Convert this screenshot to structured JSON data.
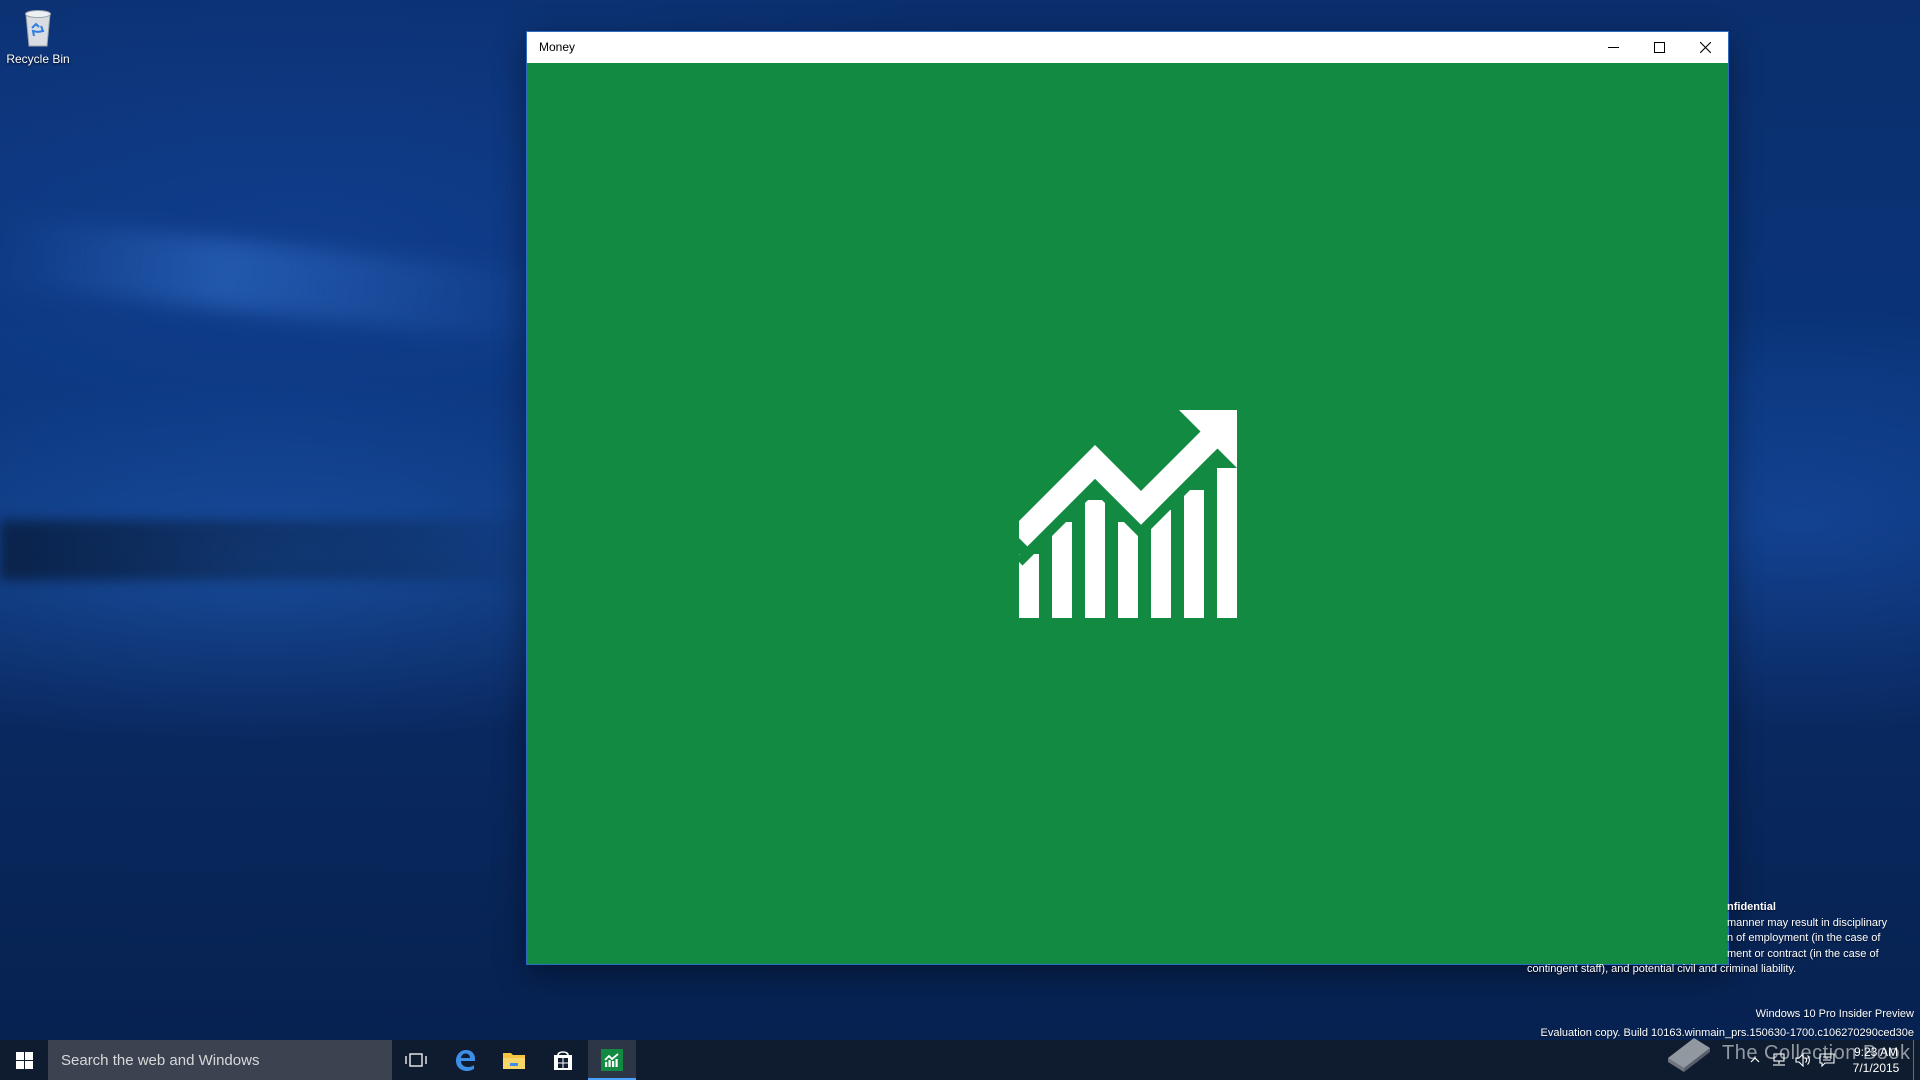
{
  "desktop": {
    "recycle_bin_label": "Recycle Bin"
  },
  "window": {
    "title": "Money",
    "controls": [
      "minimize",
      "maximize",
      "close"
    ],
    "splash_color": "#138a42",
    "splash_icon": "money-chart-icon"
  },
  "watermark": {
    "confidential_title": "nfidential",
    "confidential_lines": [
      "manner may result in disciplinary",
      "n of employment (in the case of",
      "ment or contract (in the case of",
      "contingent staff), and potential civil and criminal liability."
    ],
    "edition": "Windows 10 Pro Insider Preview",
    "build": "Evaluation copy. Build 10163.winmain_prs.150630-1700.c106270290ced30e"
  },
  "taskbar": {
    "search_placeholder": "Search the web and Windows",
    "pinned": [
      "task-view-icon",
      "edge-icon",
      "file-explorer-icon",
      "store-icon",
      "money-app-icon"
    ],
    "active_app": "money-app-icon",
    "accent": "#4aa3ff",
    "clock_time": "9:23 AM",
    "clock_date": "7/1/2015",
    "site_mark": "The Collection Book"
  }
}
